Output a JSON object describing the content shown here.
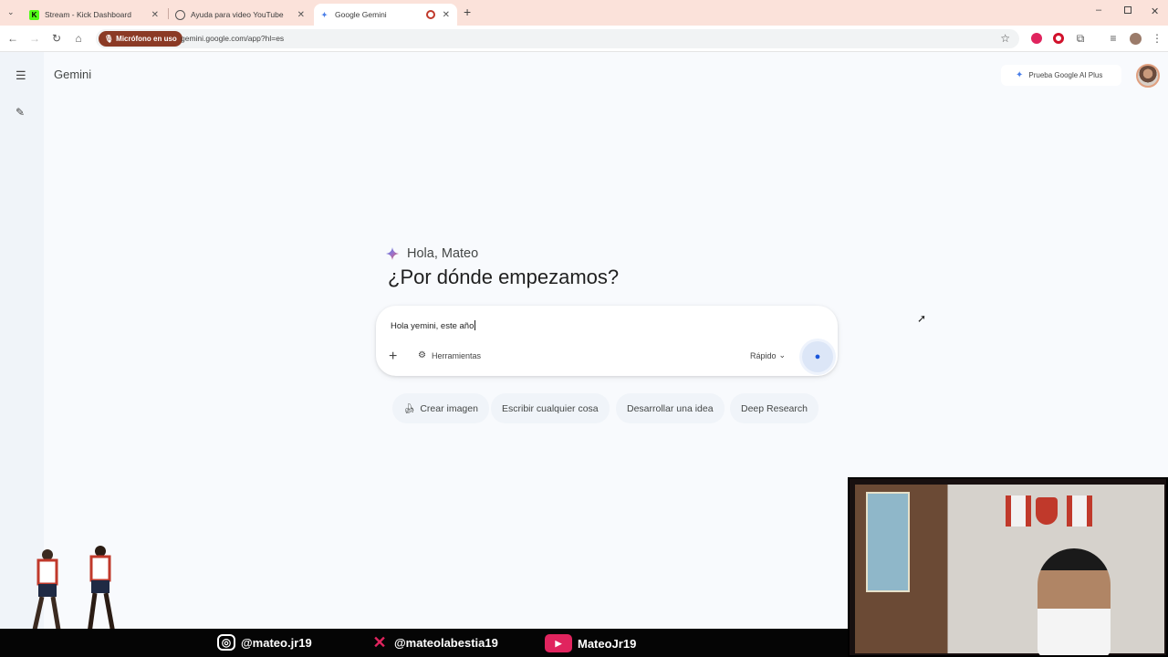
{
  "browser": {
    "tabs": [
      {
        "title": "Stream - Kick Dashboard",
        "icon": "kick-icon"
      },
      {
        "title": "Ayuda para video YouTube",
        "icon": "chatgpt-icon"
      },
      {
        "title": "Google Gemini",
        "icon": "gemini-icon"
      }
    ],
    "mic_chip": "Micrófono en uso",
    "url": "gemini.google.com/app?hl=es"
  },
  "app": {
    "name": "Gemini",
    "upgrade_label": "Prueba Google AI Plus"
  },
  "greeting": {
    "small": "Hola, Mateo",
    "big": "¿Por dónde empezamos?"
  },
  "composer": {
    "text": "Hola yemini, este año",
    "tools_label": "Herramientas",
    "model_label": "Rápido"
  },
  "suggestions": [
    {
      "label": "Crear imagen",
      "icon": "banana-icon"
    },
    {
      "label": "Escribir cualquier cosa"
    },
    {
      "label": "Desarrollar una idea"
    },
    {
      "label": "Deep Research"
    }
  ],
  "overlay": {
    "socials": [
      {
        "network": "instagram-icon",
        "handle": "@mateo.jr19"
      },
      {
        "network": "x-icon",
        "handle": "@mateolabestia19"
      },
      {
        "network": "youtube-icon",
        "handle": "MateoJr19"
      }
    ]
  },
  "colors": {
    "tabstrip": "#fbe2da",
    "mic_chip": "#8b3a25",
    "accent_blue": "#1a56db"
  }
}
